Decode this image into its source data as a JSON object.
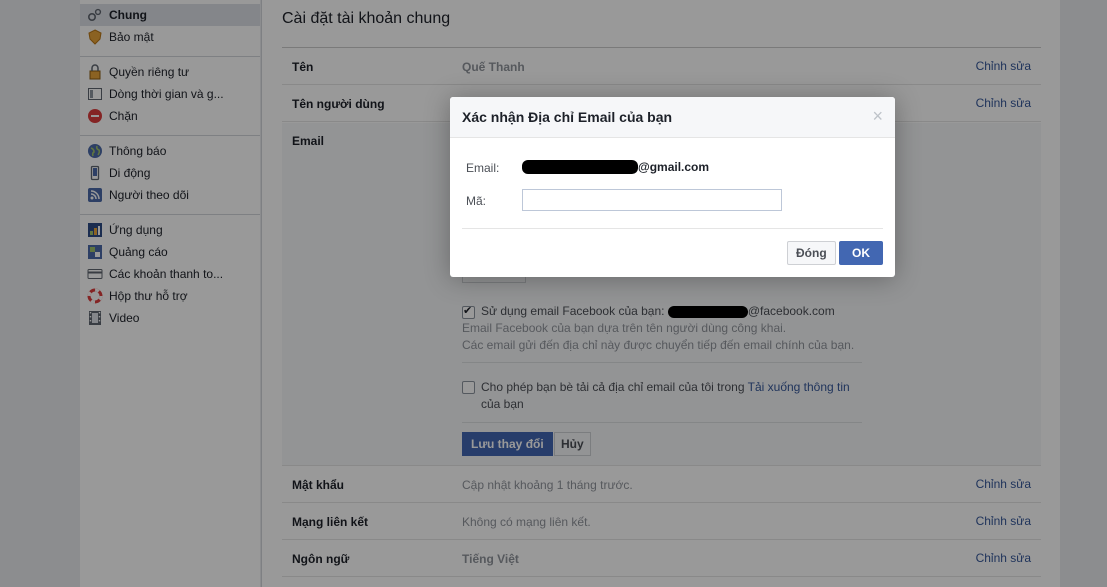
{
  "sidebar": {
    "groups": [
      [
        {
          "label": "Chung",
          "icon": "gears-icon",
          "active": true
        },
        {
          "label": "Bảo mật",
          "icon": "shield-badge-icon"
        }
      ],
      [
        {
          "label": "Quyền riêng tư",
          "icon": "lock-icon"
        },
        {
          "label": "Dòng thời gian và g...",
          "icon": "timeline-icon"
        },
        {
          "label": "Chặn",
          "icon": "block-icon"
        }
      ],
      [
        {
          "label": "Thông báo",
          "icon": "globe-icon"
        },
        {
          "label": "Di động",
          "icon": "mobile-icon"
        },
        {
          "label": "Người theo dõi",
          "icon": "rss-icon"
        }
      ],
      [
        {
          "label": "Ứng dụng",
          "icon": "apps-icon"
        },
        {
          "label": "Quảng cáo",
          "icon": "ads-icon"
        },
        {
          "label": "Các khoản thanh to...",
          "icon": "card-icon"
        },
        {
          "label": "Hộp thư hỗ trợ",
          "icon": "lifebuoy-icon"
        },
        {
          "label": "Video",
          "icon": "film-icon"
        }
      ]
    ]
  },
  "main": {
    "title": "Cài đặt tài khoản chung",
    "edit_label": "Chỉnh sửa",
    "rows_top": [
      {
        "key": "Tên",
        "value": "Quế Thanh",
        "bold": true
      },
      {
        "key": "Tên người dùng",
        "value": ""
      }
    ],
    "email": {
      "key": "Email",
      "fb_email_label": "Sử dụng email Facebook của bạn:",
      "fb_email_domain": "@facebook.com",
      "fb_email_desc1": "Email Facebook của bạn dựa trên tên người dùng công khai.",
      "fb_email_desc2": "Các email gửi đến địa chỉ này được chuyển tiếp đến email chính của bạn.",
      "download_text": "Cho phép bạn bè tải cả địa chỉ email của tôi trong",
      "download_link": "Tải xuống thông tin",
      "download_text2": "của bạn",
      "save_label": "Lưu thay đổi",
      "cancel_label": "Hủy"
    },
    "rows_bottom": [
      {
        "key": "Mật khẩu",
        "value": "Cập nhật khoảng 1 tháng trước."
      },
      {
        "key": "Mạng liên kết",
        "value": "Không có mạng liên kết."
      },
      {
        "key": "Ngôn ngữ",
        "value": "Tiếng Việt",
        "bold": true
      }
    ]
  },
  "dialog": {
    "title": "Xác nhận Địa chỉ Email của bạn",
    "close_glyph": "×",
    "email_label": "Email:",
    "email_domain": "@gmail.com",
    "code_label": "Mã:",
    "code_value": "",
    "close_button": "Đóng",
    "ok_button": "OK"
  },
  "colors": {
    "accent": "#4267b2",
    "link": "#365899",
    "overlay": "rgba(0,0,0,0.4)"
  }
}
